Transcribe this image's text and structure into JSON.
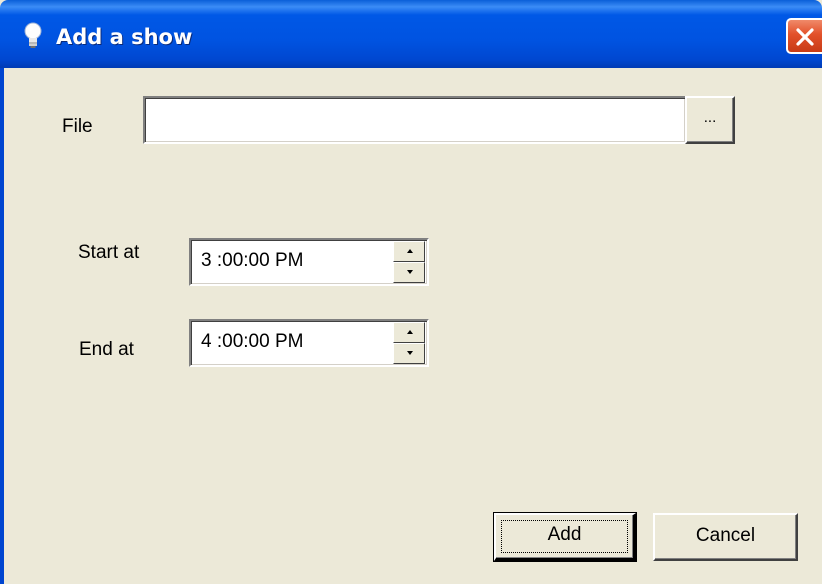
{
  "window": {
    "title": "Add a show",
    "title_icon": "lightbulb-icon",
    "close_icon": "close-icon"
  },
  "file": {
    "label": "File",
    "value": "",
    "browse_label": "..."
  },
  "start": {
    "label": "Start at",
    "value": "3 :00:00 PM"
  },
  "end": {
    "label": "End at",
    "value": "4 :00:00 PM"
  },
  "buttons": {
    "add_label": "Add",
    "cancel_label": "Cancel"
  },
  "colors": {
    "titlebar": "#0054e3",
    "dialog_bg": "#ece9d8",
    "close_button": "#e2512a"
  }
}
